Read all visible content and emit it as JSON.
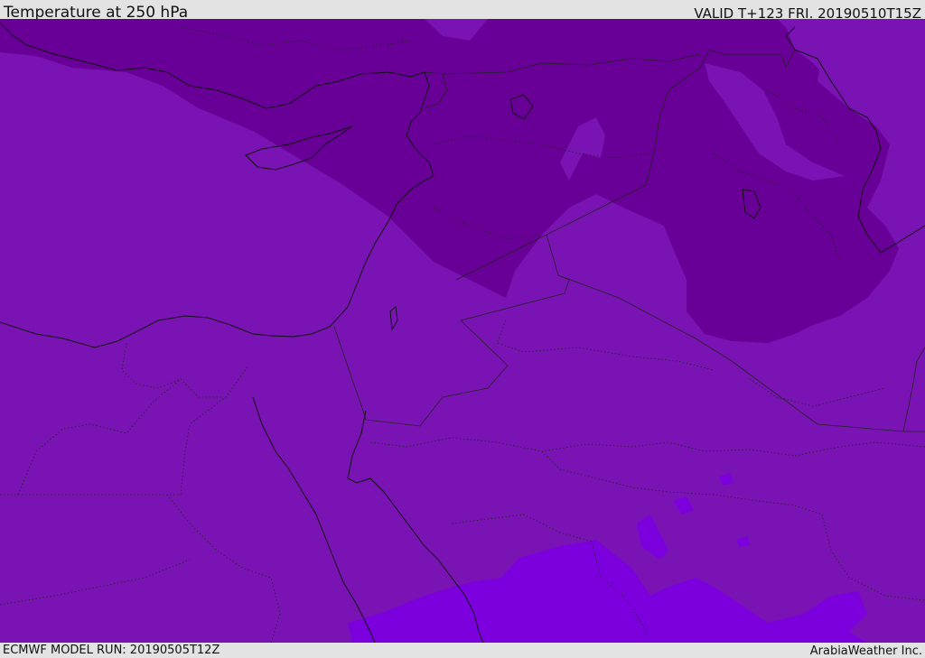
{
  "header": {
    "title": "Temperature at 250 hPa",
    "valid_time": "VALID T+123 FRI. 20190510T15Z"
  },
  "footer": {
    "model_run": "ECMWF MODEL RUN: 20190505T12Z",
    "credit": "ArabiaWeather Inc."
  },
  "map": {
    "field": "Temperature at 250 hPa",
    "colors": {
      "band_cold": "#680097",
      "band_mid": "#7a13b3",
      "band_warm": "#7b00dd",
      "coastline": "#111111",
      "borders": "#222222"
    }
  }
}
